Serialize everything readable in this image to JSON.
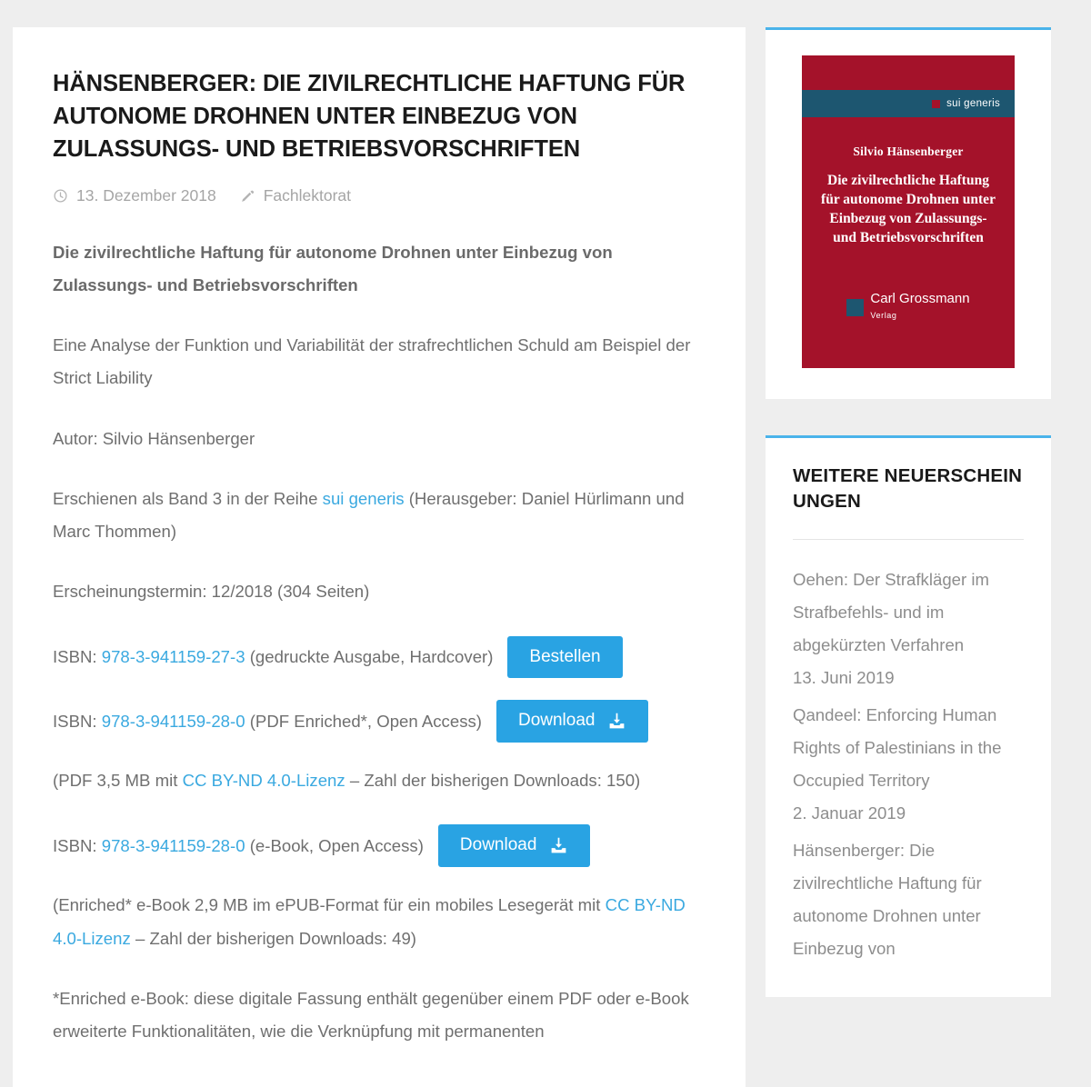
{
  "article": {
    "title": "Hänsenberger: Die zivilrechtliche Haftung für autonome Drohnen unter Einbezug von Zulassungs- und Betriebsvorschriften",
    "meta": {
      "date_icon": "clock-icon",
      "date": "13. Dezember 2018",
      "category_icon": "pencil-icon",
      "category": "Fachlektorat"
    },
    "lead": "Die zivilrechtliche Haftung für autonome Drohnen unter Einbezug von Zulassungs- und Betriebsvorschriften",
    "subtitle": "Eine Analyse der Funktion und Variabilität der strafrechtlichen Schuld am Beispiel der Strict Liability",
    "author_line": "Autor: Silvio Hänsenberger",
    "series": {
      "before": "Erschienen als Band 3 in der Reihe ",
      "link": "sui generis",
      "after": " (Herausgeber: Daniel Hürlimann und Marc Thommen)"
    },
    "publication_date": "Erscheinungstermin: 12/2018 (304 Seiten)",
    "isbn_rows": [
      {
        "prefix": "ISBN: ",
        "isbn": "978-3-941159-27-3",
        "suffix": " (gedruckte Ausgabe, Hardcover)",
        "button_label": "Bestellen",
        "button_icon": ""
      },
      {
        "prefix": "ISBN: ",
        "isbn": "978-3-941159-28-0",
        "suffix": " (PDF Enriched*, Open Access)",
        "button_label": "Download",
        "button_icon": "download-icon"
      },
      {
        "prefix": "ISBN: ",
        "isbn": "978-3-941159-28-0",
        "suffix": " (e-Book, Open Access)",
        "button_label": "Download",
        "button_icon": "download-icon"
      }
    ],
    "pdf_note": {
      "before": "(PDF 3,5 MB mit ",
      "link": "CC BY-ND 4.0-Lizenz",
      "after": " – Zahl der bisherigen Downloads: 150)"
    },
    "epub_note": {
      "before": "(Enriched* e-Book 2,9 MB im ePUB-Format für ein mobiles Lesegerät mit ",
      "link": "CC BY-ND 4.0-Lizenz",
      "after": " – Zahl der bisherigen Downloads: 49)"
    },
    "footnote": "*Enriched e-Book: diese digitale Fassung enthält gegenüber einem PDF oder e-Book erweiterte Funktionalitäten, wie die Verknüpfung mit permanenten"
  },
  "sidebar": {
    "cover": {
      "band_label": "sui generis",
      "author": "Silvio Hänsenberger",
      "title": "Die zivilrechtliche Haftung für autonome Drohnen unter Einbezug von Zulassungs- und Betriebsvorschriften",
      "publisher_name": "Carl Grossmann",
      "publisher_sub": "Verlag"
    },
    "news_widget": {
      "title": "Weitere Neuerscheinungen",
      "items": [
        {
          "title": "Oehen: Der Strafkläger im Strafbefehls- und im abgekürzten Verfahren",
          "date": "13. Juni 2019"
        },
        {
          "title": "Qandeel: Enforcing Human Rights of Palestinians in the Occupied Territory",
          "date": "2. Januar 2019"
        },
        {
          "title": "Hänsenberger: Die zivilrechtliche Haftung für autonome Drohnen unter Einbezug von",
          "date": ""
        }
      ]
    }
  },
  "colors": {
    "accent_blue": "#29a3e3",
    "link_blue": "#3aa9e0",
    "widget_border": "#4ab3ea",
    "cover_red": "#a4122a",
    "cover_band": "#1d5670",
    "page_bg": "#eeeeee",
    "body_text": "#6f6f6f"
  }
}
